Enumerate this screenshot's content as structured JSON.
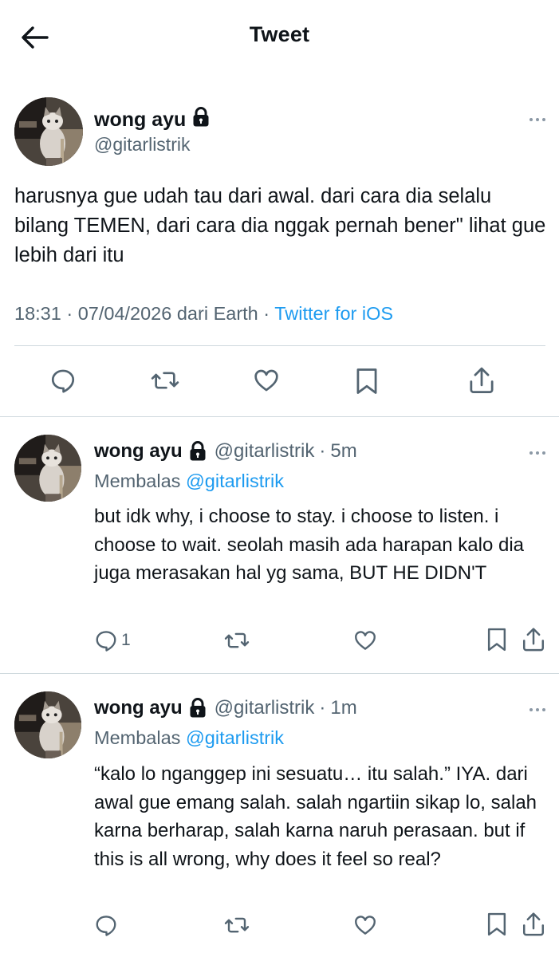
{
  "header": {
    "title": "Tweet",
    "back_icon": "arrow-left-icon"
  },
  "main_tweet": {
    "author": {
      "name": "wong ayu",
      "handle": "@gitarlistrik",
      "protected_icon": "lock-icon"
    },
    "text": "harusnya gue udah tau dari awal. dari cara dia selalu bilang TEMEN, dari cara dia nggak pernah bener\" lihat gue lebih dari itu",
    "meta": {
      "time": "18:31",
      "separator1": "·",
      "date": "07/04/2026",
      "location": "dari Earth",
      "separator2": "·",
      "source": "Twitter for iOS"
    },
    "actions": [
      "reply-icon",
      "retweet-icon",
      "like-icon",
      "bookmark-icon",
      "share-icon"
    ]
  },
  "replies": [
    {
      "author": {
        "name": "wong ayu",
        "handle": "@gitarlistrik"
      },
      "dot": "·",
      "time": "5m",
      "replying_label": "Membalas",
      "replying_to": "@gitarlistrik",
      "text": "but idk why, i choose to stay. i choose to listen. i choose to wait. seolah masih ada harapan kalo dia juga merasakan hal yg sama, BUT HE DIDN'T",
      "reply_count": "1"
    },
    {
      "author": {
        "name": "wong ayu",
        "handle": "@gitarlistrik"
      },
      "dot": "·",
      "time": "1m",
      "replying_label": "Membalas",
      "replying_to": "@gitarlistrik",
      "text": "“kalo lo nganggep ini sesuatu… itu salah.” IYA. dari awal gue emang salah. salah ngartiin sikap lo, salah karna berharap, salah karna naruh perasaan. but if this is all wrong, why does it feel so real?",
      "reply_count": ""
    }
  ],
  "colors": {
    "text": "#0f1419",
    "secondary": "#536471",
    "link": "#1d9bf0",
    "divider": "#cfd9de"
  }
}
